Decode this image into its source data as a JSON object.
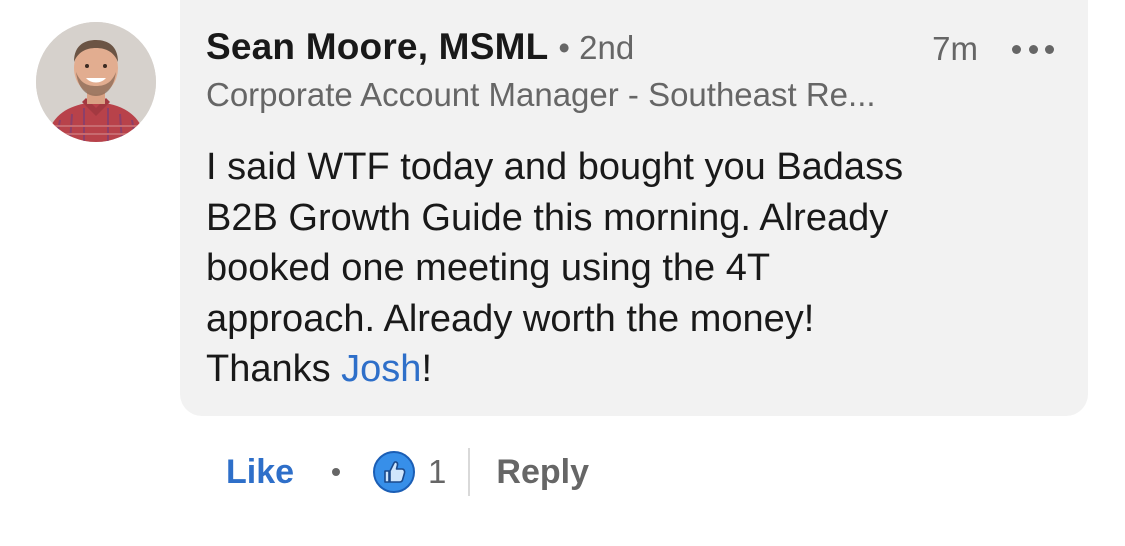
{
  "comment": {
    "author": {
      "name": "Sean Moore, MSML",
      "degree": "• 2nd",
      "headline": "Corporate Account Manager - Southeast Re..."
    },
    "timestamp": "7m",
    "more_icon": "more-horizontal-icon",
    "text": {
      "lines": [
        "I said WTF today and bought you Badass",
        "B2B Growth Guide this morning. Already",
        "booked one meeting using the 4T",
        "approach. Already worth the money!"
      ],
      "last_line_prefix": "Thanks ",
      "mention": "Josh",
      "last_line_suffix": "!"
    }
  },
  "actions": {
    "like_label": "Like",
    "reaction_icon": "thumbs-up-icon",
    "reaction_count": "1",
    "reply_label": "Reply"
  },
  "colors": {
    "bubble_bg": "#f2f2f2",
    "link_blue": "#2e6fc9",
    "secondary_text": "#666666",
    "primary_text": "#191919"
  }
}
